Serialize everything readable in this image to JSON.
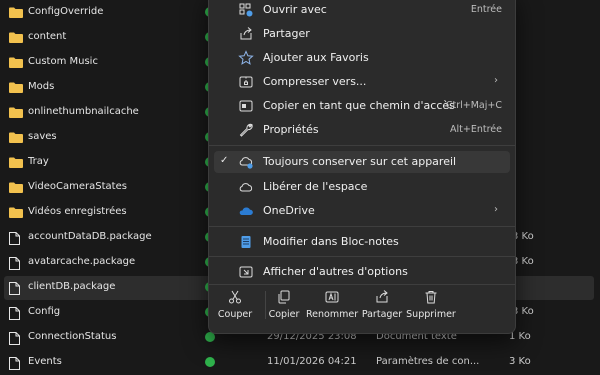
{
  "files": [
    {
      "name": "ConfigOverride",
      "kind": "folder",
      "status": true,
      "date": "",
      "type": "",
      "size": ""
    },
    {
      "name": "content",
      "kind": "folder",
      "status": true,
      "date": "",
      "type": "",
      "size": ""
    },
    {
      "name": "Custom Music",
      "kind": "folder",
      "status": true,
      "date": "",
      "type": "",
      "size": ""
    },
    {
      "name": "Mods",
      "kind": "folder",
      "status": true,
      "date": "",
      "type": "",
      "size": ""
    },
    {
      "name": "onlinethumbnailcache",
      "kind": "folder",
      "status": true,
      "date": "",
      "type": "",
      "size": ""
    },
    {
      "name": "saves",
      "kind": "folder",
      "status": true,
      "date": "",
      "type": "",
      "size": ""
    },
    {
      "name": "Tray",
      "kind": "folder",
      "status": true,
      "date": "",
      "type": "",
      "size": ""
    },
    {
      "name": "VideoCameraStates",
      "kind": "folder",
      "status": true,
      "date": "",
      "type": "",
      "size": ""
    },
    {
      "name": "Vidéos enregistrées",
      "kind": "folder",
      "status": true,
      "date": "",
      "type": "",
      "size": ""
    },
    {
      "name": "accountDataDB.package",
      "kind": "file",
      "status": true,
      "date": "",
      "type": "",
      "size": "3 Ko"
    },
    {
      "name": "avatarcache.package",
      "kind": "file",
      "status": true,
      "date": "",
      "type": "",
      "size": "3 Ko"
    },
    {
      "name": "clientDB.package",
      "kind": "file",
      "status": true,
      "date": "",
      "type": "",
      "size": ""
    },
    {
      "name": "Config",
      "kind": "file",
      "status": true,
      "date": "",
      "type": "",
      "size": "3 Ko"
    },
    {
      "name": "ConnectionStatus",
      "kind": "file",
      "status": true,
      "date": "29/12/2025 23:08",
      "type": "Document texte",
      "size": "1 Ko"
    },
    {
      "name": "Events",
      "kind": "file",
      "status": true,
      "date": "11/01/2026 04:21",
      "type": "Paramètres de con...",
      "size": "3 Ko"
    }
  ],
  "menu": {
    "items": [
      {
        "label": "Ouvrir avec",
        "shortcut": "Entrée",
        "icon": "open-with-icon"
      },
      {
        "label": "Partager",
        "shortcut": "",
        "icon": "share-icon"
      },
      {
        "label": "Ajouter aux Favoris",
        "shortcut": "",
        "icon": "star-icon"
      },
      {
        "label": "Compresser vers...",
        "shortcut": "",
        "icon": "zip-icon",
        "arrow": "›"
      },
      {
        "label": "Copier en tant que chemin d'accès",
        "shortcut": "Ctrl+Maj+C",
        "icon": "copy-path-icon"
      },
      {
        "label": "Propriétés",
        "shortcut": "Alt+Entrée",
        "icon": "wrench-icon"
      },
      {
        "label": "Toujours conserver sur cet appareil",
        "shortcut": "",
        "icon": "cloud-sync-icon",
        "check": "✓"
      },
      {
        "label": "Libérer de l'espace",
        "shortcut": "",
        "icon": "cloud-icon"
      },
      {
        "label": "OneDrive",
        "shortcut": "",
        "icon": "onedrive-icon",
        "arrow": "›"
      },
      {
        "label": "Modifier dans Bloc-notes",
        "shortcut": "",
        "icon": "notepad-icon"
      },
      {
        "label": "Afficher d'autres d'options",
        "shortcut": "",
        "icon": "more-options-icon"
      }
    ],
    "actions": [
      {
        "label": "Couper",
        "icon": "cut-icon"
      },
      {
        "label": "Copier",
        "icon": "copy-icon"
      },
      {
        "label": "Renommer",
        "icon": "rename-icon"
      },
      {
        "label": "Partager",
        "icon": "share-icon"
      },
      {
        "label": "Supprimer",
        "icon": "trash-icon"
      }
    ]
  },
  "colors": {
    "background": "#191919",
    "menu_bg": "#2b2b2b",
    "status_green": "#2fb24c",
    "folder_yellow": "#f2c14e",
    "onedrive_blue": "#2b7cd3"
  }
}
